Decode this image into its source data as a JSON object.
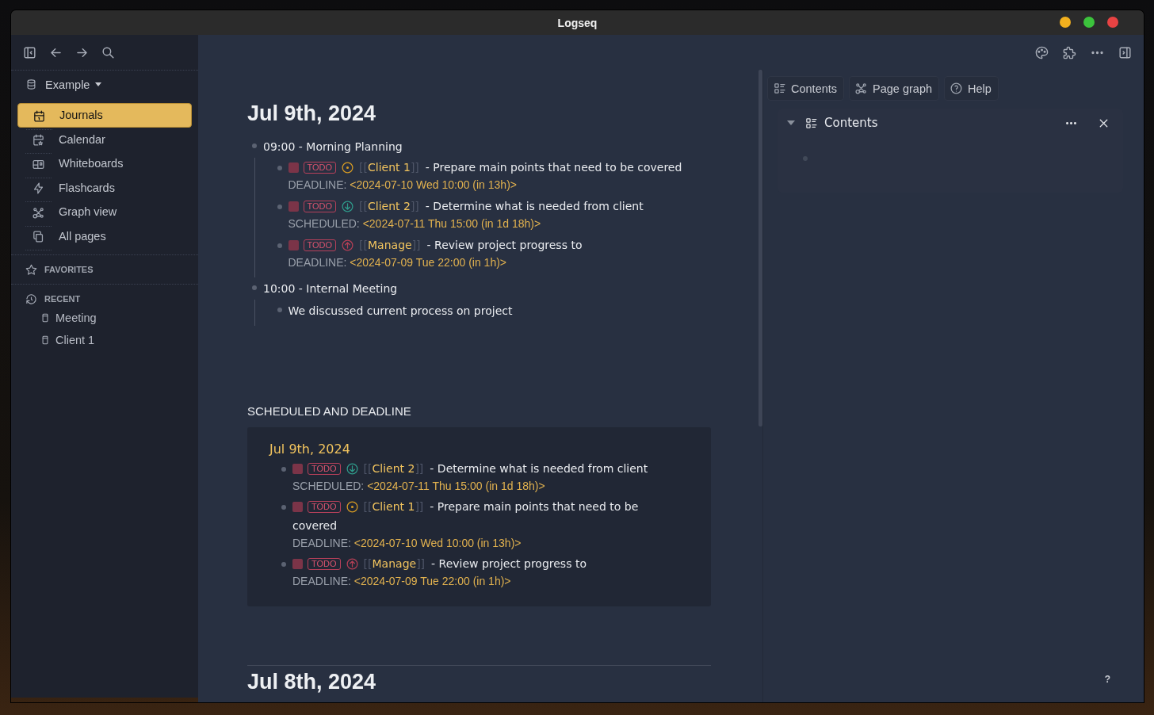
{
  "window": {
    "title": "Logseq",
    "controls": [
      {
        "kind": "minimize"
      },
      {
        "kind": "maximize"
      },
      {
        "kind": "close"
      }
    ]
  },
  "sidebar": {
    "graph": "Example",
    "nav": [
      {
        "label": "Journals",
        "selected": true
      },
      {
        "label": "Calendar",
        "selected": false
      },
      {
        "label": "Whiteboards",
        "selected": false
      },
      {
        "label": "Flashcards",
        "selected": false
      },
      {
        "label": "Graph view",
        "selected": false
      },
      {
        "label": "All pages",
        "selected": false
      }
    ],
    "favorites": {
      "title": "FAVORITES"
    },
    "recent": {
      "title": "RECENT",
      "items": [
        "Meeting",
        "Client 1"
      ]
    }
  },
  "journal": {
    "title": "Jul 9th, 2024",
    "blocks": [
      {
        "kind": "text",
        "text": "09:00 - Morning Planning",
        "children": [
          {
            "kind": "task",
            "checked": false,
            "marker": "TODO",
            "priority": {
              "kind": "medium",
              "color": "#d49a24"
            },
            "ref": {
              "open": "[[",
              "page": "Client 1",
              "close": "]]"
            },
            "text": "- Prepare main points that need to be covered",
            "property": {
              "label": "DEADLINE:",
              "value": "<2024-07-10 Wed 10:00 (in 13h)>"
            }
          },
          {
            "kind": "task",
            "checked": false,
            "marker": "TODO",
            "priority": {
              "kind": "low",
              "color": "#2f9a8a"
            },
            "ref": {
              "open": "[[",
              "page": "Client 2",
              "close": "]]"
            },
            "text": "- Determine what is needed from client",
            "property": {
              "label": "SCHEDULED:",
              "value": "<2024-07-11 Thu 15:00 (in 1d 18h)>"
            }
          },
          {
            "kind": "task",
            "checked": false,
            "marker": "TODO",
            "priority": {
              "kind": "high",
              "color": "#b23f55"
            },
            "ref": {
              "open": "[[",
              "page": "Manage",
              "close": "]]"
            },
            "text": "- Review project progress to",
            "property": {
              "label": "DEADLINE:",
              "value": "<2024-07-09 Tue 22:00 (in 1h)>"
            }
          }
        ]
      },
      {
        "kind": "text",
        "text": "10:00 - Internal Meeting",
        "children": [
          {
            "kind": "text",
            "text": "We discussed current process on project"
          }
        ]
      }
    ]
  },
  "scheduled": {
    "title": "SCHEDULED AND DEADLINE",
    "date": "Jul 9th, 2024",
    "tasks": [
      {
        "kind": "task",
        "checked": false,
        "marker": "TODO",
        "priority": {
          "kind": "low",
          "color": "#2f9a8a"
        },
        "ref": {
          "open": "[[",
          "page": "Client 2",
          "close": "]]"
        },
        "text": "- Determine what is needed from client",
        "property": {
          "label": "SCHEDULED:",
          "value": "<2024-07-11 Thu 15:00 (in 1d 18h)>"
        }
      },
      {
        "kind": "task",
        "checked": false,
        "marker": "TODO",
        "priority": {
          "kind": "medium",
          "color": "#d49a24"
        },
        "ref": {
          "open": "[[",
          "page": "Client 1",
          "close": "]]"
        },
        "text": "- Prepare main points that need to be covered",
        "property": {
          "label": "DEADLINE:",
          "value": "<2024-07-10 Wed 10:00 (in 13h)>"
        }
      },
      {
        "kind": "task",
        "checked": false,
        "marker": "TODO",
        "priority": {
          "kind": "high",
          "color": "#b23f55"
        },
        "ref": {
          "open": "[[",
          "page": "Manage",
          "close": "]]"
        },
        "text": "- Review project progress to",
        "property": {
          "label": "DEADLINE:",
          "value": "<2024-07-09 Tue 22:00 (in 1h)>"
        }
      }
    ]
  },
  "next_journal": {
    "title": "Jul 8th, 2024"
  },
  "right_sidebar": {
    "buttons": [
      {
        "label": "Contents"
      },
      {
        "label": "Page graph"
      },
      {
        "label": "Help"
      }
    ],
    "panel": {
      "title": "Contents",
      "expanded": true
    }
  },
  "help_button": "?"
}
